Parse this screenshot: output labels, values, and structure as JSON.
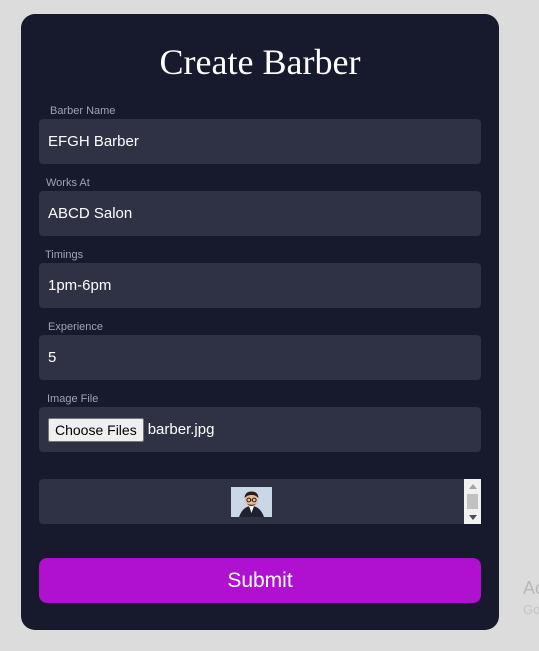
{
  "form": {
    "title": "Create Barber",
    "fields": [
      {
        "label": "Barber Name",
        "value": "EFGH Barber"
      },
      {
        "label": "Works At",
        "value": "ABCD Salon"
      },
      {
        "label": "Timings",
        "value": "1pm-6pm"
      },
      {
        "label": "Experience",
        "value": "5"
      }
    ],
    "image_file": {
      "label": "Image File",
      "button_label": "Choose Files",
      "file_name": "barber.jpg"
    },
    "submit_label": "Submit"
  },
  "watermark": {
    "line1": "Ac",
    "line2": "Go"
  },
  "colors": {
    "page_bg": "#dcdcdc",
    "card_bg": "#161a2c",
    "field_bg": "#2f3244",
    "label_text": "#9ea3b3",
    "submit_bg": "#b010d0"
  }
}
